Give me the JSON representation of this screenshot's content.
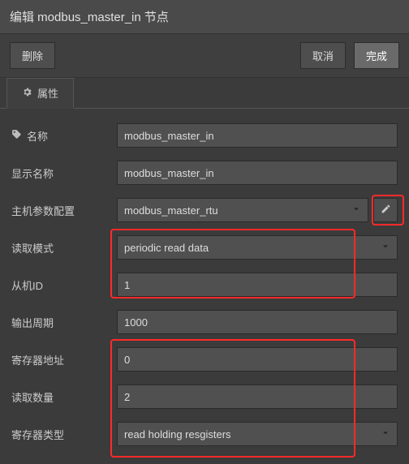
{
  "title": "编辑 modbus_master_in 节点",
  "buttons": {
    "delete": "删除",
    "cancel": "取消",
    "done": "完成"
  },
  "tab": {
    "properties": "属性"
  },
  "labels": {
    "name": "名称",
    "displayName": "显示名称",
    "hostConfig": "主机参数配置",
    "readMode": "读取模式",
    "slaveId": "从机ID",
    "outputPeriod": "输出周期",
    "regAddr": "寄存器地址",
    "readCount": "读取数量",
    "regType": "寄存器类型"
  },
  "values": {
    "name": "modbus_master_in",
    "displayName": "modbus_master_in",
    "hostConfig": "modbus_master_rtu",
    "readMode": "periodic read data",
    "slaveId": "1",
    "outputPeriod": "1000",
    "regAddr": "0",
    "readCount": "2",
    "regType": "read holding resgisters"
  }
}
